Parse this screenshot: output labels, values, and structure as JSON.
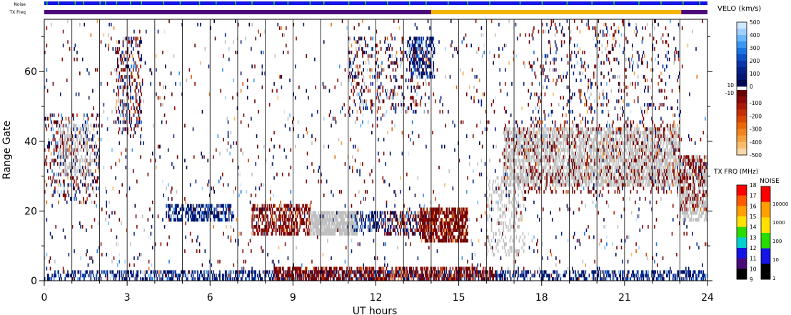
{
  "chart_data": {
    "type": "heatmap",
    "xlabel": "UT hours",
    "ylabel": "Range Gate",
    "x_ticks": [
      0,
      3,
      6,
      9,
      12,
      15,
      18,
      21,
      24
    ],
    "y_ticks": [
      0,
      20,
      40,
      60
    ],
    "xlim": [
      0,
      24
    ],
    "ylim": [
      0,
      75
    ],
    "grid": "vertical lines each hour",
    "strip_labels": [
      "Noise",
      "TX Freq"
    ],
    "noise_strip": {
      "base_color": "#1414e6",
      "marker_color": "#22dd22",
      "marker_hours": [
        0.08,
        0.5,
        1.1,
        1.4,
        2.0,
        2.2,
        2.6,
        3.1,
        3.5,
        4.3,
        4.9,
        5.6,
        6.2,
        6.9,
        7.5,
        8.3,
        8.8,
        9.6,
        10.1,
        11.0,
        11.6,
        12.4,
        13.2,
        13.8,
        14.6,
        15.3,
        16.1,
        17.2,
        18.0,
        18.9,
        19.8,
        20.6,
        21.5,
        22.3,
        23.1,
        23.7
      ]
    },
    "tx_freq_strip": [
      {
        "start": 0,
        "end": 14,
        "color": "#4b0a7a"
      },
      {
        "start": 14,
        "end": 23.05,
        "color": "#f3b500"
      },
      {
        "start": 23.05,
        "end": 24,
        "color": "#4b0a7a"
      }
    ],
    "velocity_colorbar": {
      "title": "VELO (km/s)",
      "positive_ticks": [
        500,
        400,
        300,
        200,
        100,
        0
      ],
      "negative_ticks": [
        -100,
        -200,
        -300,
        -400,
        -500
      ],
      "gap_labels": [
        "10",
        "-10"
      ],
      "positive_colors": [
        "#cfe6ff",
        "#9fd0ff",
        "#6ab6ff",
        "#3a96f0",
        "#1a74e0",
        "#0f50c8",
        "#0a34a8",
        "#06228a",
        "#041670",
        "#000a50"
      ],
      "negative_colors": [
        "#6a0000",
        "#8a0a0a",
        "#a81a08",
        "#c42e06",
        "#d84a04",
        "#e86808",
        "#f08420",
        "#f5a040",
        "#f8bc6a",
        "#fad8a8"
      ]
    },
    "freq_colorbar": {
      "title": "TX FRQ (MHz)",
      "ticks": [
        18,
        17,
        16,
        15,
        14,
        13,
        12,
        11,
        10,
        9
      ],
      "colors": [
        "#ff0000",
        "#ff5a00",
        "#ffa000",
        "#ffe000",
        "#28dc00",
        "#00d0d0",
        "#1414e6",
        "#4b0a7a",
        "#000000"
      ]
    },
    "noise_colorbar": {
      "title": "NOISE",
      "ticks": [
        10000,
        1000,
        100,
        10,
        1
      ],
      "colors": [
        "#ff0000",
        "#ffa000",
        "#ffe000",
        "#28dc00",
        "#1414e6",
        "#000000"
      ]
    },
    "ground_scatter_color": "#c0c0c0",
    "regions": [
      {
        "x0": 0.0,
        "x1": 2.0,
        "g0": 22,
        "g1": 48,
        "density": 0.22,
        "palette": "mixed"
      },
      {
        "x0": 0.5,
        "x1": 1.7,
        "g0": 30,
        "g1": 45,
        "density": 0.35,
        "palette": "gray"
      },
      {
        "x0": 2.6,
        "x1": 3.5,
        "g0": 42,
        "g1": 70,
        "density": 0.28,
        "palette": "mixed"
      },
      {
        "x0": 4.4,
        "x1": 6.8,
        "g0": 17,
        "g1": 22,
        "density": 0.55,
        "palette": "blue"
      },
      {
        "x0": 7.5,
        "x1": 9.6,
        "g0": 13,
        "g1": 22,
        "density": 0.5,
        "palette": "red"
      },
      {
        "x0": 9.6,
        "x1": 11.3,
        "g0": 13,
        "g1": 20,
        "density": 0.85,
        "palette": "gray"
      },
      {
        "x0": 11.1,
        "x1": 12.3,
        "g0": 14,
        "g1": 20,
        "density": 0.35,
        "palette": "blue"
      },
      {
        "x0": 12.3,
        "x1": 14.0,
        "g0": 13,
        "g1": 20,
        "density": 0.45,
        "palette": "mixed"
      },
      {
        "x0": 13.6,
        "x1": 15.3,
        "g0": 11,
        "g1": 21,
        "density": 0.75,
        "palette": "red"
      },
      {
        "x0": 11.0,
        "x1": 13.8,
        "g0": 48,
        "g1": 70,
        "density": 0.18,
        "palette": "mixed"
      },
      {
        "x0": 13.2,
        "x1": 14.1,
        "g0": 58,
        "g1": 70,
        "density": 0.45,
        "palette": "blue"
      },
      {
        "x0": 16.6,
        "x1": 23.0,
        "g0": 27,
        "g1": 44,
        "density": 0.6,
        "palette": "gray"
      },
      {
        "x0": 16.6,
        "x1": 23.0,
        "g0": 25,
        "g1": 46,
        "density": 0.12,
        "palette": "red"
      },
      {
        "x0": 16.0,
        "x1": 17.4,
        "g0": 7,
        "g1": 30,
        "density": 0.22,
        "palette": "gray"
      },
      {
        "x0": 17.5,
        "x1": 23.0,
        "g0": 44,
        "g1": 75,
        "density": 0.08,
        "palette": "mixed"
      },
      {
        "x0": 23.0,
        "x1": 24.0,
        "g0": 17,
        "g1": 36,
        "density": 0.5,
        "palette": "gray"
      },
      {
        "x0": 23.0,
        "x1": 24.0,
        "g0": 20,
        "g1": 36,
        "density": 0.28,
        "palette": "red"
      },
      {
        "x0": 0.0,
        "x1": 24.0,
        "g0": 0,
        "g1": 3,
        "density": 0.45,
        "palette": "blue"
      },
      {
        "x0": 8.3,
        "x1": 16.3,
        "g0": 0,
        "g1": 4,
        "density": 0.55,
        "palette": "red"
      },
      {
        "x0": 0.0,
        "x1": 24.0,
        "g0": 0,
        "g1": 75,
        "density": 0.025,
        "palette": "mixed"
      }
    ]
  }
}
